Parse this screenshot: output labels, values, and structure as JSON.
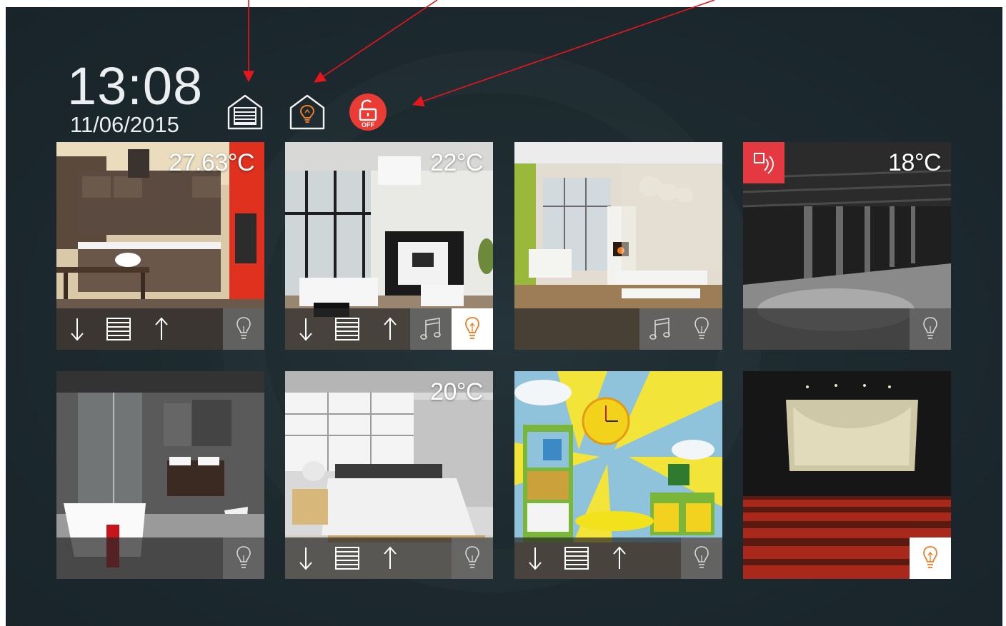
{
  "clock": {
    "time": "13:08",
    "date": "11/06/2015"
  },
  "status_icons": [
    {
      "name": "garage-shutter-icon"
    },
    {
      "name": "house-light-icon"
    },
    {
      "name": "alarm-off-icon",
      "label": "OFF"
    }
  ],
  "colors": {
    "background": "#1d2a2f",
    "accent_orange": "#f07c22",
    "alarm_red": "#e53941",
    "callout_arrow": "#e8151b"
  },
  "rooms": [
    {
      "id": "kitchen",
      "temperature": "27.63°C",
      "controls": [
        "arrow-down-icon",
        "shutter-icon",
        "arrow-up-icon",
        "light-bulb-icon"
      ],
      "light_on": false
    },
    {
      "id": "living-room",
      "temperature": "22°C",
      "controls": [
        "arrow-down-icon",
        "shutter-icon",
        "arrow-up-icon",
        "music-note-icon",
        "light-bulb-icon"
      ],
      "light_on": true
    },
    {
      "id": "dining-room",
      "temperature": "",
      "controls": [
        "music-note-icon",
        "light-bulb-icon"
      ],
      "light_on": false
    },
    {
      "id": "garage",
      "temperature": "18°C",
      "controls": [
        "motion-sensor-icon",
        "light-bulb-icon"
      ],
      "light_on": false
    },
    {
      "id": "bathroom",
      "temperature": "",
      "controls": [
        "light-bulb-icon"
      ],
      "light_on": false
    },
    {
      "id": "bedroom",
      "temperature": "20°C",
      "controls": [
        "arrow-down-icon",
        "shutter-icon",
        "arrow-up-icon",
        "light-bulb-icon"
      ],
      "light_on": false
    },
    {
      "id": "kids-room",
      "temperature": "",
      "controls": [
        "arrow-down-icon",
        "shutter-icon",
        "arrow-up-icon",
        "light-bulb-icon"
      ],
      "light_on": false
    },
    {
      "id": "home-cinema",
      "temperature": "",
      "controls": [
        "light-bulb-icon"
      ],
      "light_on": true
    }
  ]
}
